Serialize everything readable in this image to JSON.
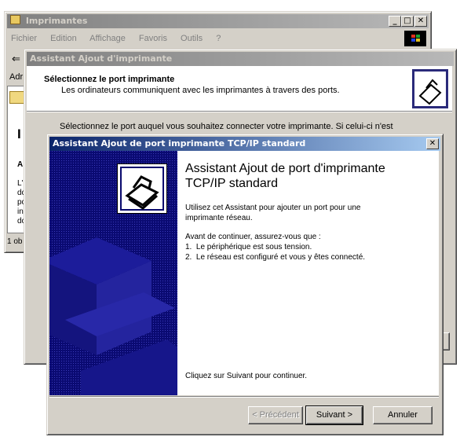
{
  "explorer": {
    "title": "Imprimantes",
    "menu": [
      "Fichier",
      "Edition",
      "Affichage",
      "Favoris",
      "Outils",
      "?"
    ],
    "address_fragment": "Adr",
    "panel_letters": [
      "I",
      "A",
      "L'",
      "dc",
      "pc",
      "in",
      "dc"
    ],
    "status": "1 ob"
  },
  "add_printer_wizard": {
    "title": "Assistant Ajout d'imprimante",
    "header_title": "Sélectionnez le port imprimante",
    "header_subtitle": "Les ordinateurs communiquent avec les imprimantes à travers des ports.",
    "body_text": "Sélectionnez le port auquel vous souhaitez connecter votre imprimante. Si celui-ci n'est"
  },
  "tcpip_wizard": {
    "title": "Assistant Ajout de port imprimante TCP/IP standard",
    "close_label": "✕",
    "heading": "Assistant Ajout de port d'imprimante TCP/IP standard",
    "intro": "Utilisez cet Assistant pour ajouter un port pour une imprimante réseau.",
    "before_label": "Avant de continuer, assurez-vous que :",
    "items": [
      "1.  Le périphérique est sous tension.",
      "2.  Le réseau est configuré et vous y êtes connecté."
    ],
    "continue_text": "Cliquez sur Suivant pour continuer.",
    "buttons": {
      "back": "< Précédent",
      "next": "Suivant >",
      "cancel": "Annuler"
    }
  }
}
